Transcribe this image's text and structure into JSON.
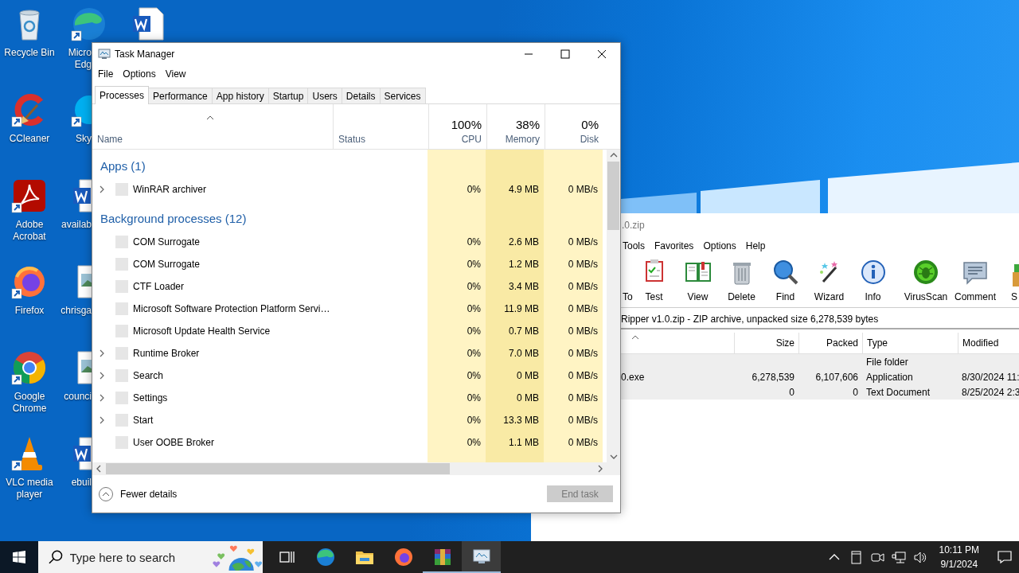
{
  "desktop": {
    "icons": [
      {
        "label": "Recycle Bin",
        "shortcut": false
      },
      {
        "label": "CCleaner",
        "shortcut": true
      },
      {
        "label": "Adobe Acrobat",
        "shortcut": true
      },
      {
        "label": "Firefox",
        "shortcut": true
      },
      {
        "label": "Google Chrome",
        "shortcut": true
      },
      {
        "label": "VLC media player",
        "shortcut": true
      },
      {
        "label": "Micro Edg",
        "shortcut": true
      },
      {
        "label": "Sky",
        "shortcut": true
      },
      {
        "label": "availab",
        "shortcut": false
      },
      {
        "label": "chrisga",
        "shortcut": false
      },
      {
        "label": "counci",
        "shortcut": false
      },
      {
        "label": "ebuil",
        "shortcut": false
      },
      {
        "shortcut": false
      }
    ]
  },
  "winrar": {
    "title": ".0.zip",
    "menu": [
      "Tools",
      "Favorites",
      "Options",
      "Help"
    ],
    "toolbar": [
      "To",
      "Test",
      "View",
      "Delete",
      "Find",
      "Wizard",
      "Info",
      "VirusScan",
      "Comment",
      "S"
    ],
    "address": "Ripper v1.0.zip - ZIP archive, unpacked size 6,278,539 bytes",
    "columns": [
      "Size",
      "Packed",
      "Type",
      "Modified"
    ],
    "rows": [
      {
        "type": "File folder"
      },
      {
        "name": "0.exe",
        "size": "6,278,539",
        "packed": "6,107,606",
        "type": "Application",
        "modified": "8/30/2024 11:"
      },
      {
        "size": "0",
        "packed": "0",
        "type": "Text Document",
        "modified": "8/25/2024 2:3"
      }
    ]
  },
  "task_manager": {
    "title": "Task Manager",
    "menu": [
      "File",
      "Options",
      "View"
    ],
    "tabs": [
      {
        "label": "Processes",
        "selected": true
      },
      {
        "label": "Performance",
        "selected": false
      },
      {
        "label": "App history",
        "selected": false
      },
      {
        "label": "Startup",
        "selected": false
      },
      {
        "label": "Users",
        "selected": false
      },
      {
        "label": "Details",
        "selected": false
      },
      {
        "label": "Services",
        "selected": false
      }
    ],
    "columns": [
      {
        "label": "Name"
      },
      {
        "label": "Status"
      },
      {
        "percent": "100%",
        "label": "CPU"
      },
      {
        "percent": "38%",
        "label": "Memory"
      },
      {
        "percent": "0%",
        "label": "Disk"
      }
    ],
    "groups": [
      {
        "title": "Apps (1)",
        "processes": [
          {
            "name": "WinRAR archiver",
            "expandable": true,
            "cpu": "0%",
            "memory": "4.9 MB",
            "disk": "0 MB/s"
          }
        ]
      },
      {
        "title": "Background processes (12)",
        "processes": [
          {
            "name": "COM Surrogate",
            "expandable": false,
            "cpu": "0%",
            "memory": "2.6 MB",
            "disk": "0 MB/s"
          },
          {
            "name": "COM Surrogate",
            "expandable": false,
            "cpu": "0%",
            "memory": "1.2 MB",
            "disk": "0 MB/s"
          },
          {
            "name": "CTF Loader",
            "expandable": false,
            "cpu": "0%",
            "memory": "3.4 MB",
            "disk": "0 MB/s"
          },
          {
            "name": "Microsoft Software Protection Platform Servi…",
            "expandable": false,
            "cpu": "0%",
            "memory": "11.9 MB",
            "disk": "0 MB/s"
          },
          {
            "name": "Microsoft Update Health Service",
            "expandable": false,
            "cpu": "0%",
            "memory": "0.7 MB",
            "disk": "0 MB/s"
          },
          {
            "name": "Runtime Broker",
            "expandable": true,
            "cpu": "0%",
            "memory": "7.0 MB",
            "disk": "0 MB/s"
          },
          {
            "name": "Search",
            "expandable": true,
            "cpu": "0%",
            "memory": "0 MB",
            "disk": "0 MB/s"
          },
          {
            "name": "Settings",
            "expandable": true,
            "cpu": "0%",
            "memory": "0 MB",
            "disk": "0 MB/s"
          },
          {
            "name": "Start",
            "expandable": true,
            "cpu": "0%",
            "memory": "13.3 MB",
            "disk": "0 MB/s"
          },
          {
            "name": "User OOBE Broker",
            "expandable": false,
            "cpu": "0%",
            "memory": "1.1 MB",
            "disk": "0 MB/s"
          }
        ]
      }
    ],
    "footer": {
      "toggle": "Fewer details",
      "end_task": {
        "label": "End task",
        "disabled": true
      }
    }
  },
  "taskbar": {
    "search_placeholder": "Type here to search",
    "apps": [
      {
        "running": false,
        "active": false
      },
      {
        "running": false,
        "active": false
      },
      {
        "running": false,
        "active": false
      },
      {
        "running": true,
        "active": false
      },
      {
        "running": true,
        "active": true
      }
    ],
    "time": "10:11 PM",
    "date": "9/1/2024"
  }
}
